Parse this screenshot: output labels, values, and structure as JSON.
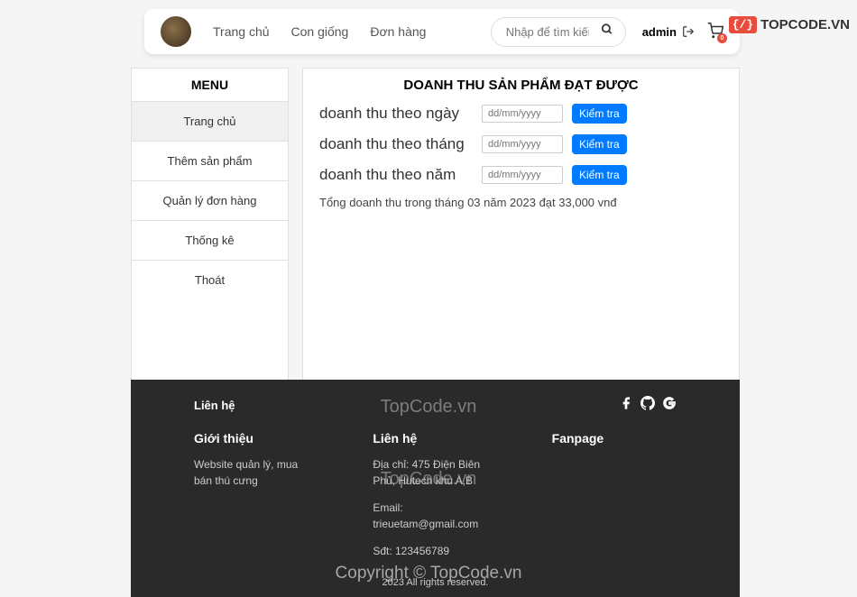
{
  "nav": {
    "links": [
      "Trang chủ",
      "Con giống",
      "Đơn hàng"
    ]
  },
  "search": {
    "placeholder": "Nhập để tìm kiếm..."
  },
  "user": {
    "name": "admin"
  },
  "cart": {
    "badge": "0"
  },
  "sidebar": {
    "title": "MENU",
    "items": [
      "Trang chủ",
      "Thêm sản phẩm",
      "Quản lý đơn hàng",
      "Thống kê",
      "Thoát"
    ]
  },
  "panel": {
    "title": "DOANH THU SẢN PHẨM ĐẠT ĐƯỢC",
    "rows": [
      {
        "label": "doanh thu theo ngày",
        "placeholder": "dd/mm/yyyy",
        "btn": "Kiểm tra"
      },
      {
        "label": "doanh thu theo tháng",
        "placeholder": "dd/mm/yyyy",
        "btn": "Kiểm tra"
      },
      {
        "label": "doanh thu theo năm",
        "placeholder": "dd/mm/yyyy",
        "btn": "Kiểm tra"
      }
    ],
    "summary": "Tổng doanh thu trong tháng 03 năm 2023 đạt 33,000 vnđ"
  },
  "footer": {
    "contact_link": "Liên hệ",
    "col1": {
      "title": "Giới thiệu",
      "text": "Website quản lý, mua bán thú cưng"
    },
    "col2": {
      "title": "Liên hệ",
      "address": "Địa chỉ: 475 Điện Biên Phủ, Hutech khu A,B",
      "email": "Email: trieuetam@gmail.com",
      "phone": "Sđt: 123456789"
    },
    "col3": {
      "title": "Fanpage"
    },
    "bottom": "2023 All rights reserved."
  },
  "watermark": {
    "brand": "TOPCODE.VN",
    "badge": "{/}",
    "text1": "TopCode.vn",
    "text2": "TopCode.vn",
    "text3": "Copyright © TopCode.vn"
  }
}
